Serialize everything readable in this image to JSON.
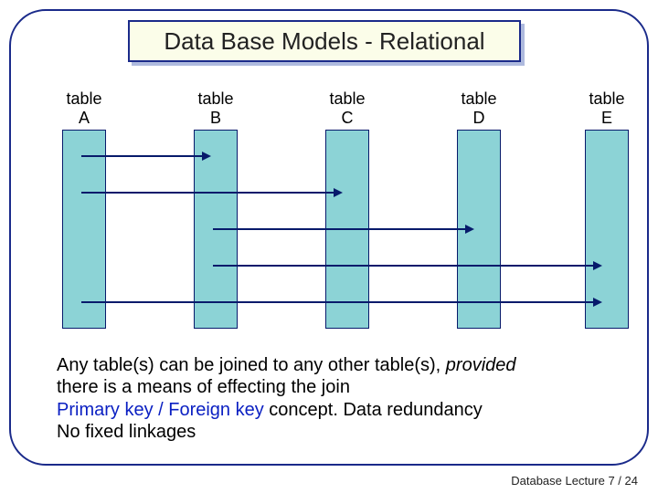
{
  "title": "Data Base Models - Relational",
  "tables": {
    "a": {
      "label": "table\nA"
    },
    "b": {
      "label": "table\nB"
    },
    "c": {
      "label": "table\nC"
    },
    "d": {
      "label": "table\nD"
    },
    "e": {
      "label": "table\nE"
    }
  },
  "body": {
    "line1a": "Any table(s) can be joined to any other table(s), ",
    "line1b_italic": "provided",
    "line2": "there is a means of effecting the join",
    "line3_concept": "Primary key / Foreign key",
    "line3_rest": "  concept.    Data redundancy",
    "line4": "No fixed linkages"
  },
  "footer": "Database  Lecture 7 /  24",
  "chart_data": {
    "type": "diagram",
    "title": "Data Base Models - Relational",
    "nodes": [
      "table A",
      "table B",
      "table C",
      "table D",
      "table E"
    ],
    "edges": [
      {
        "from": "table A",
        "to": "table B",
        "row": 1
      },
      {
        "from": "table A",
        "to": "table C",
        "row": 2
      },
      {
        "from": "table B",
        "to": "table D",
        "row": 3
      },
      {
        "from": "table B",
        "to": "table E",
        "row": 4
      },
      {
        "from": "table A",
        "to": "table E",
        "row": 5
      }
    ],
    "annotations": [
      "Any table(s) can be joined to any other table(s), provided there is a means of effecting the join",
      "Primary key / Foreign key concept.  Data redundancy",
      "No fixed linkages"
    ]
  }
}
